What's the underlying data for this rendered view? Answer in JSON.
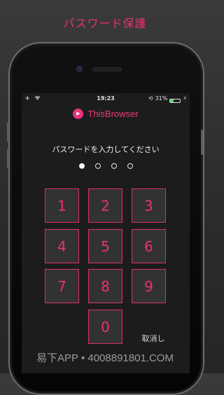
{
  "banner": {
    "title": "パスワード保護"
  },
  "status_bar": {
    "time": "19:23",
    "battery": "31%",
    "airplane_icon": "airplane-icon",
    "wifi_icon": "wifi-icon",
    "rotation_lock_icon": "rotation-lock-icon",
    "charging_icon": "charging-icon",
    "battery_level": 0.31
  },
  "app": {
    "title": "ThisBrowser",
    "logo_icon": "play-icon"
  },
  "passcode": {
    "prompt": "パスワードを入力してください",
    "length": 4,
    "entered": 1
  },
  "keypad": {
    "keys": [
      "1",
      "2",
      "3",
      "4",
      "5",
      "6",
      "7",
      "8",
      "9",
      "0"
    ],
    "cancel_label": "取消し"
  },
  "watermark": {
    "text": "易下APP • 4008891801.COM"
  },
  "colors": {
    "accent": "#e8336b",
    "key_bg": "#333233",
    "screen_bg": "#1c1c1c"
  }
}
